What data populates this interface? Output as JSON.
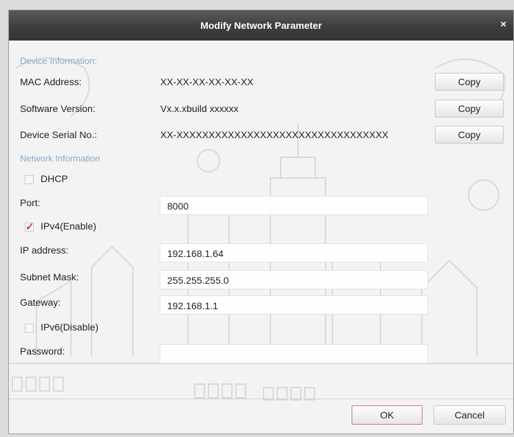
{
  "dialog": {
    "title": "Modify Network Parameter",
    "close_glyph": "×"
  },
  "device_info": {
    "section_label": "Device Information:",
    "mac_label": "MAC Address:",
    "mac_value": "XX-XX-XX-XX-XX-XX",
    "software_label": "Software Version:",
    "software_value": "Vx.x.xbuild xxxxxx",
    "serial_label": "Device Serial No.:",
    "serial_value": "XX-XXXXXXXXXXXXXXXXXXXXXXXXXXXXXXXXX",
    "copy_label": "Copy"
  },
  "network_info": {
    "section_label": "Network Information",
    "dhcp_label": "DHCP",
    "dhcp_checked": false,
    "port_label": "Port:",
    "port_value": "8000",
    "ipv4_label": "IPv4(Enable)",
    "ipv4_checked": true,
    "ip_label": "IP address:",
    "ip_value": "192.168.1.64",
    "subnet_label": "Subnet Mask:",
    "subnet_value": "255.255.255.0",
    "gateway_label": "Gateway:",
    "gateway_value": "192.168.1.1",
    "ipv6_label": "IPv6(Disable)",
    "ipv6_checked": false,
    "password_label": "Password:",
    "password_value": ""
  },
  "buttons": {
    "ok_label": "OK",
    "cancel_label": "Cancel"
  },
  "colors": {
    "titlebar": "#3d3d3d",
    "section_text": "#8aa9c8",
    "ok_border": "#e06b74",
    "check_mark": "#d23b3b"
  }
}
